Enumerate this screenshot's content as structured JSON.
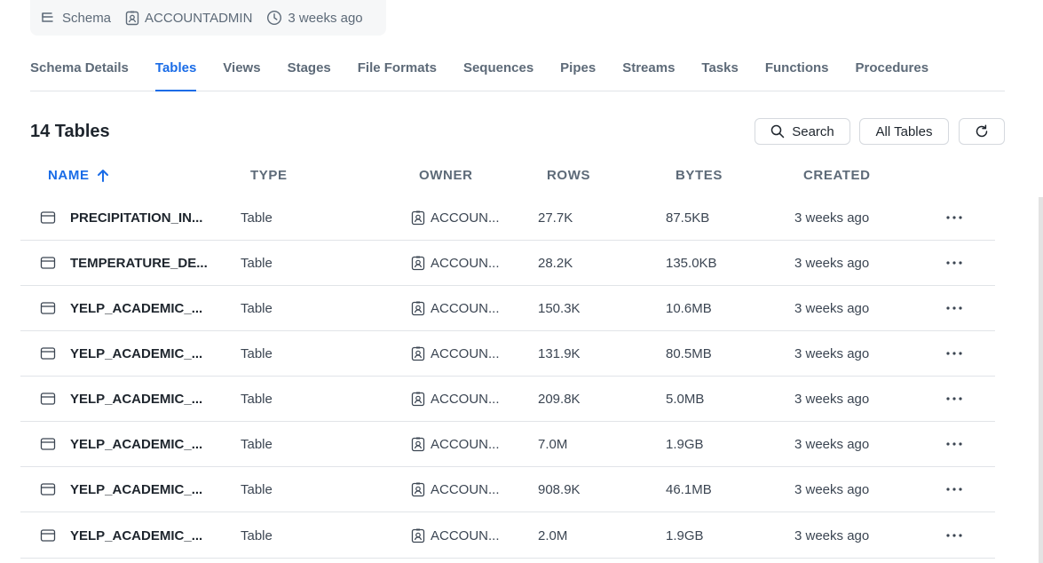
{
  "meta": {
    "type_label": "Schema",
    "owner": "ACCOUNTADMIN",
    "created": "3 weeks ago"
  },
  "tabs": [
    {
      "label": "Schema Details"
    },
    {
      "label": "Tables"
    },
    {
      "label": "Views"
    },
    {
      "label": "Stages"
    },
    {
      "label": "File Formats"
    },
    {
      "label": "Sequences"
    },
    {
      "label": "Pipes"
    },
    {
      "label": "Streams"
    },
    {
      "label": "Tasks"
    },
    {
      "label": "Functions"
    },
    {
      "label": "Procedures"
    }
  ],
  "active_tab": "Tables",
  "heading": {
    "count_title": "14 Tables"
  },
  "toolbar": {
    "search_label": "Search",
    "filter_label": "All Tables"
  },
  "columns": {
    "name": "NAME",
    "type": "TYPE",
    "owner": "OWNER",
    "rows": "ROWS",
    "bytes": "BYTES",
    "created": "CREATED"
  },
  "sort": {
    "column": "name",
    "direction": "ascending"
  },
  "rows": [
    {
      "name": "PRECIPITATION_IN...",
      "type": "Table",
      "owner": "ACCOUN...",
      "rows": "27.7K",
      "bytes": "87.5KB",
      "created": "3 weeks ago"
    },
    {
      "name": "TEMPERATURE_DE...",
      "type": "Table",
      "owner": "ACCOUN...",
      "rows": "28.2K",
      "bytes": "135.0KB",
      "created": "3 weeks ago"
    },
    {
      "name": "YELP_ACADEMIC_...",
      "type": "Table",
      "owner": "ACCOUN...",
      "rows": "150.3K",
      "bytes": "10.6MB",
      "created": "3 weeks ago"
    },
    {
      "name": "YELP_ACADEMIC_...",
      "type": "Table",
      "owner": "ACCOUN...",
      "rows": "131.9K",
      "bytes": "80.5MB",
      "created": "3 weeks ago"
    },
    {
      "name": "YELP_ACADEMIC_...",
      "type": "Table",
      "owner": "ACCOUN...",
      "rows": "209.8K",
      "bytes": "5.0MB",
      "created": "3 weeks ago"
    },
    {
      "name": "YELP_ACADEMIC_...",
      "type": "Table",
      "owner": "ACCOUN...",
      "rows": "7.0M",
      "bytes": "1.9GB",
      "created": "3 weeks ago"
    },
    {
      "name": "YELP_ACADEMIC_...",
      "type": "Table",
      "owner": "ACCOUN...",
      "rows": "908.9K",
      "bytes": "46.1MB",
      "created": "3 weeks ago"
    },
    {
      "name": "YELP_ACADEMIC_...",
      "type": "Table",
      "owner": "ACCOUN...",
      "rows": "2.0M",
      "bytes": "1.9GB",
      "created": "3 weeks ago"
    }
  ],
  "colors": {
    "accent": "#1a6ce7",
    "muted_text": "#5d6a78",
    "border": "#e1e4e8"
  }
}
